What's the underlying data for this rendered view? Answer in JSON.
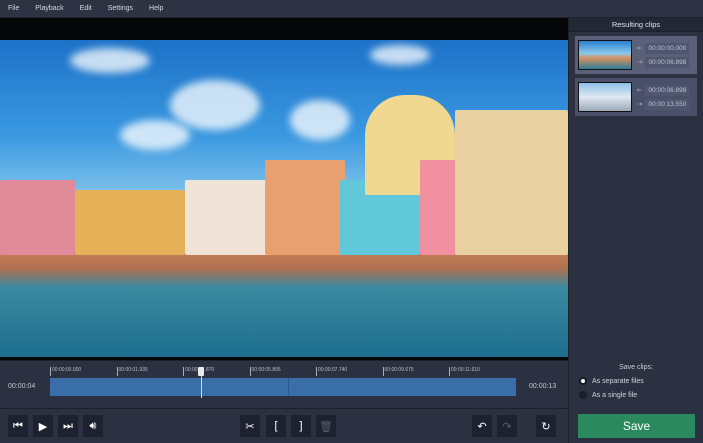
{
  "menu": [
    "File",
    "Playback",
    "Edit",
    "Settings",
    "Help"
  ],
  "side": {
    "title": "Resulting clips",
    "clips": [
      {
        "start": "00:00:00.000",
        "end": "00:00:06.898"
      },
      {
        "start": "00:00:06.898",
        "end": "00:00:13.550"
      }
    ]
  },
  "timeline": {
    "current": "00:00:04",
    "total": "00:00:13",
    "ticks": [
      "00:00:00.000",
      "00:00:01.935",
      "00:00:03.870",
      "00:00:05.805",
      "00:00:07.740",
      "00:00:09.675",
      "00:00:11.610"
    ],
    "playhead_fraction": 0.325
  },
  "save": {
    "label": "Save clips:",
    "opt1": "As separate files",
    "opt2": "As a single file",
    "button": "Save"
  },
  "colors": {
    "accent": "#2a8a5e",
    "track": "#3a6ea8"
  }
}
